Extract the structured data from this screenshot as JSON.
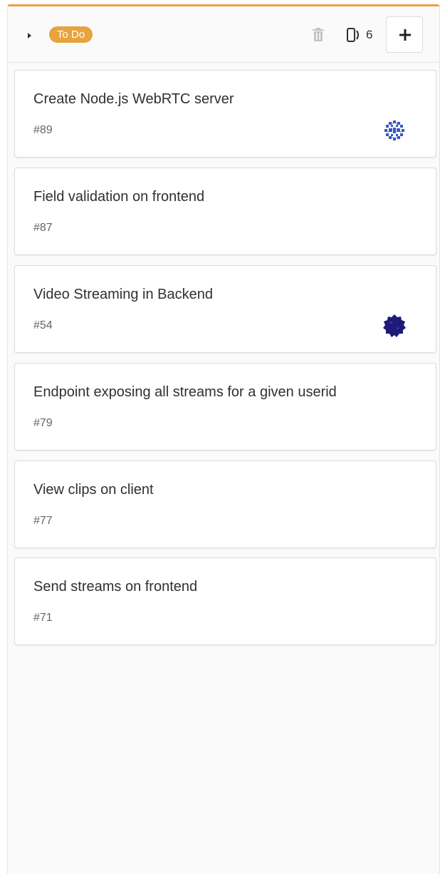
{
  "column": {
    "label": "To Do",
    "accent_color": "#e8a33d",
    "count": "6",
    "icons": {
      "collapse": "caret-right-icon",
      "delete": "trash-icon",
      "issues": "issue-count-icon",
      "add": "plus-icon"
    }
  },
  "cards": [
    {
      "title": "Create Node.js WebRTC server",
      "ref": "#89",
      "avatar": "identicon-light"
    },
    {
      "title": "Field validation on frontend",
      "ref": "#87",
      "avatar": ""
    },
    {
      "title": "Video Streaming in Backend",
      "ref": "#54",
      "avatar": "identicon-dark"
    },
    {
      "title": "Endpoint exposing all streams for a given userid",
      "ref": "#79",
      "avatar": ""
    },
    {
      "title": "View clips on client",
      "ref": "#77",
      "avatar": ""
    },
    {
      "title": "Send streams on frontend",
      "ref": "#71",
      "avatar": ""
    }
  ]
}
